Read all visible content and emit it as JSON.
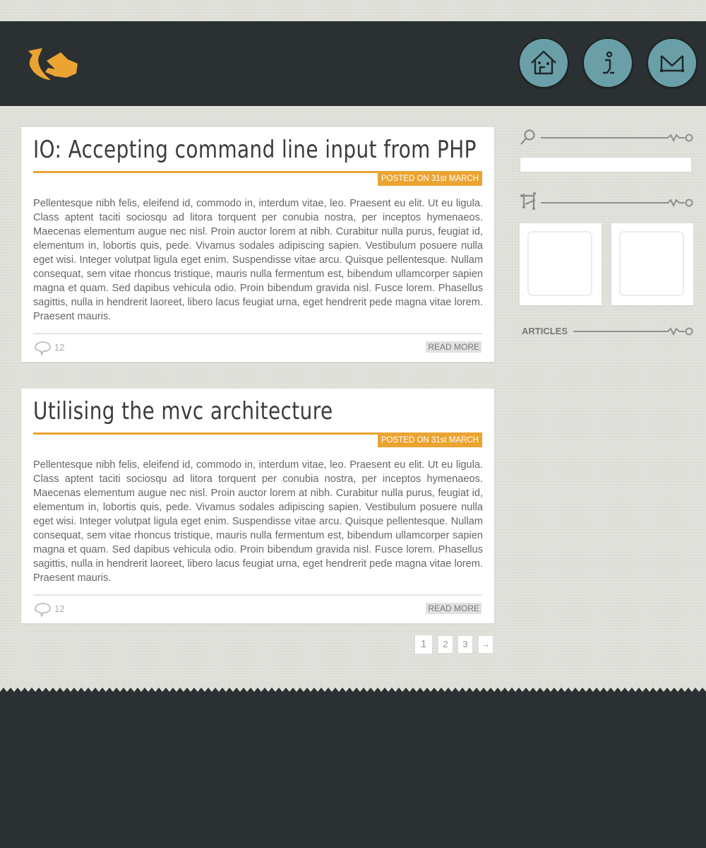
{
  "colors": {
    "accent": "#eba432",
    "header_bg": "#2b3133",
    "nav_button": "#6a9fa8",
    "page_bg": "#e2e2dc"
  },
  "header": {
    "logo": "orange-bird-logo",
    "nav": [
      {
        "icon": "home-icon"
      },
      {
        "icon": "info-icon"
      },
      {
        "icon": "mail-icon"
      }
    ]
  },
  "posts": [
    {
      "title": "IO: Accepting command line input from PHP",
      "posted": "POSTED ON 31st MARCH",
      "body": "Pellentesque nibh felis, eleifend id, commodo in, interdum vitae, leo. Praesent eu elit. Ut eu ligula. Class aptent taciti sociosqu ad litora torquent per conubia nostra, per inceptos hymenaeos. Maecenas elementum augue nec nisl. Proin auctor lorem at nibh. Curabitur nulla purus, feugiat id, elementum in, lobortis quis, pede. Vivamus sodales adipiscing sapien. Vestibulum posuere nulla eget wisi. Integer volutpat ligula eget enim. Suspendisse vitae arcu. Quisque pellentesque. Nullam consequat, sem vitae rhoncus tristique, mauris nulla fermentum est, bibendum ullamcorper sapien magna et quam. Sed dapibus vehicula odio. Proin bibendum gravida nisl. Fusce lorem. Phasellus sagittis, nulla in hendrerit laoreet, libero lacus feugiat urna, eget hendrerit pede magna vitae lorem. Praesent mauris.",
      "comments": "12",
      "read_more": "READ MORE"
    },
    {
      "title": "Utilising the mvc architecture",
      "posted": "POSTED ON 31st MARCH",
      "body": "Pellentesque nibh felis, eleifend id, commodo in, interdum vitae, leo. Praesent eu elit. Ut eu ligula. Class aptent taciti sociosqu ad litora torquent per conubia nostra, per inceptos hymenaeos. Maecenas elementum augue nec nisl. Proin auctor lorem at nibh. Curabitur nulla purus, feugiat id, elementum in, lobortis quis, pede. Vivamus sodales adipiscing sapien. Vestibulum posuere nulla eget wisi. Integer volutpat ligula eget enim. Suspendisse vitae arcu. Quisque pellentesque. Nullam consequat, sem vitae rhoncus tristique, mauris nulla fermentum est, bibendum ullamcorper sapien magna et quam. Sed dapibus vehicula odio. Proin bibendum gravida nisl. Fusce lorem. Phasellus sagittis, nulla in hendrerit laoreet, libero lacus feugiat urna, eget hendrerit pede magna vitae lorem. Praesent mauris.",
      "comments": "12",
      "read_more": "READ MORE"
    }
  ],
  "pagination": {
    "pages": [
      "1",
      "2",
      "3"
    ],
    "current": "1",
    "next": "→"
  },
  "sidebar": {
    "search": {
      "icon": "search-icon",
      "value": "",
      "placeholder": ""
    },
    "gallery": {
      "icon": "crop-icon",
      "items": 2
    },
    "articles": {
      "label": "ARTICLES"
    }
  }
}
